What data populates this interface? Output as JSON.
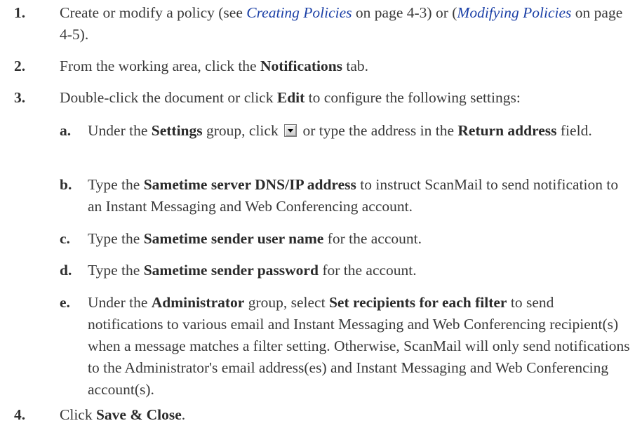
{
  "steps": {
    "s1": {
      "num": "1.",
      "text_a": "Create or modify a policy (see ",
      "link_a": "Creating Policies",
      "text_b": " on page 4-3) or (",
      "link_b": "Modifying Policies",
      "text_c": " on page 4-5)."
    },
    "s2": {
      "num": "2.",
      "text_a": "From the working area, click the ",
      "bold_a": "Notifications",
      "text_b": " tab."
    },
    "s3": {
      "num": "3.",
      "text_a": "Double-click the document or click ",
      "bold_a": "Edit",
      "text_b": " to configure the following settings:"
    },
    "s4": {
      "num": "4.",
      "text_a": "Click ",
      "bold_a": "Save & Close",
      "text_b": "."
    }
  },
  "substeps": {
    "a": {
      "letter": "a.",
      "text_a": "Under the ",
      "bold_a": "Settings",
      "text_b": " group, click ",
      "icon": "dropdown-button-icon",
      "text_c": " or type the address in the ",
      "bold_b": "Return address",
      "text_d": " field."
    },
    "b": {
      "letter": "b.",
      "text_a": "Type the ",
      "bold_a": "Sametime server DNS/IP address",
      "text_b": " to instruct ScanMail to send notification to an Instant Messaging and Web Conferencing account."
    },
    "c": {
      "letter": "c.",
      "text_a": "Type the ",
      "bold_a": "Sametime sender user name",
      "text_b": " for the account."
    },
    "d": {
      "letter": "d.",
      "text_a": "Type the ",
      "bold_a": "Sametime sender password",
      "text_b": " for the account."
    },
    "e": {
      "letter": "e.",
      "text_a": "Under the ",
      "bold_a": "Administrator",
      "text_b": " group, select ",
      "bold_b": "Set recipients for each filter",
      "text_c": " to send notifications to various email and Instant Messaging and Web Conferencing recipient(s) when a message matches a filter setting. Otherwise, ScanMail will only send notifications to the Administrator's email address(es) and Instant Messaging and Web Conferencing account(s)."
    }
  },
  "colors": {
    "text": "#3a3a3a",
    "link": "#1a3fa6"
  }
}
